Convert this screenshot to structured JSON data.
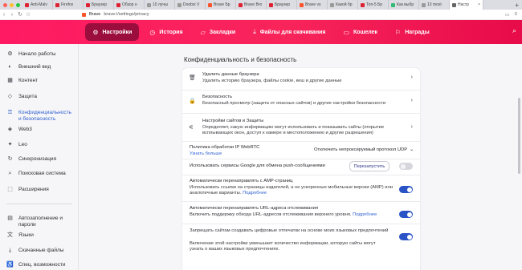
{
  "tabs": [
    {
      "label": "Anti-Malv",
      "color": "#d23"
    },
    {
      "label": "Firefox",
      "color": "#d23"
    },
    {
      "label": "Браузер",
      "color": "#d23"
    },
    {
      "label": "Обзор н",
      "color": "#d23"
    },
    {
      "label": "10 лучш",
      "color": "#999"
    },
    {
      "label": "Doobix V",
      "color": "#999"
    },
    {
      "label": "Brave Бр",
      "color": "#fb542b"
    },
    {
      "label": "Brave Bro",
      "color": "#d23"
    },
    {
      "label": "Браузер",
      "color": "#d23"
    },
    {
      "label": "Brave vs",
      "color": "#fb542b"
    },
    {
      "label": "Какой бр",
      "color": "#999"
    },
    {
      "label": "Топ-5 Бр",
      "color": "#d23"
    },
    {
      "label": "Как выбр",
      "color": "#3b7"
    },
    {
      "label": "13 most",
      "color": "#999"
    },
    {
      "label": "Настр",
      "color": "#666",
      "active": true
    }
  ],
  "address": {
    "site": "Brave",
    "path": "brave://settings/privacy"
  },
  "header": {
    "items": [
      {
        "icon": "⚙",
        "label": "Настройки",
        "active": true
      },
      {
        "icon": "◷",
        "label": "История"
      },
      {
        "icon": "▱",
        "label": "Закладки"
      },
      {
        "icon": "⤓",
        "label": "Файлы для скачивания"
      },
      {
        "icon": "▭",
        "label": "Кошелек"
      },
      {
        "icon": "⚐",
        "label": "Награды"
      }
    ]
  },
  "sidebar": {
    "items": [
      {
        "icon": "⚙",
        "label": "Начало работы"
      },
      {
        "icon": "◐",
        "label": "Внешний вид"
      },
      {
        "icon": "▦",
        "label": "Контент"
      },
      {
        "icon": "◇",
        "label": "Защита"
      },
      {
        "icon": "⚿",
        "label": "Конфиденциальность и безопасность",
        "active": true
      },
      {
        "icon": "◈",
        "label": "Web3"
      },
      {
        "icon": "✦",
        "label": "Leo"
      },
      {
        "icon": "↻",
        "label": "Синхронизация"
      },
      {
        "icon": "⌕",
        "label": "Поисковая система"
      },
      {
        "icon": "⬚",
        "label": "Расширения"
      },
      {
        "icon": "▤",
        "label": "Автозаполнение и пароли"
      },
      {
        "icon": "文",
        "label": "Языки"
      },
      {
        "icon": "⤓",
        "label": "Скачанные файлы"
      },
      {
        "icon": "♿",
        "label": "Спец. возможности"
      }
    ]
  },
  "main": {
    "section_title": "Конфиденциальность и безопасность",
    "nav_rows": [
      {
        "icon": "🗑",
        "title": "Удалить данные браузера",
        "desc": "Удалить историю браузера, файлы cookie, кеш и другие данные"
      },
      {
        "icon": "🔒",
        "title": "Безопасность",
        "desc": "Безопасный просмотр (защита от опасных сайтов) и другие настройки безопасности"
      },
      {
        "icon": "⚟",
        "title": "Настройки сайтов и Защиты",
        "desc": "Определяет, какую информацию могут использовать и показывать сайты (открытие всплывающих окон, доступ к камере и местоположению и другие разрешения)"
      }
    ],
    "webrtc": {
      "title": "Политика обработки IP WebRTC",
      "link": "Узнать больше",
      "value": "Отключить непроксируемый протокол UDP"
    },
    "push": {
      "title": "Использовать сервисы Google для обмена push-сообщениями",
      "button": "Перезапустить",
      "on": false
    },
    "amp": {
      "title": "Автоматически перенаправлять с AMP-страниц",
      "desc": "Использовать ссылки на страницы издателей, а не ускоренные мобильные версии (AMP) или аналогичные варианты.",
      "link": "Подробнее",
      "on": true
    },
    "tracking": {
      "title": "Автоматически перенаправлять URL-адреса отслеживания",
      "desc": "Включить поддержку обхода URL-адресов отслеживания верхнего уровня.",
      "link": "Подробнее",
      "on": true
    },
    "fingerprint": {
      "title": "Запрещать сайтам создавать цифровые отпечатки на основе моих языковых предпочтений",
      "desc": "Включение этой настройки уменьшает количество информации, которую сайты могут узнать о ваших языковых предпочтениях.",
      "on": true
    }
  }
}
